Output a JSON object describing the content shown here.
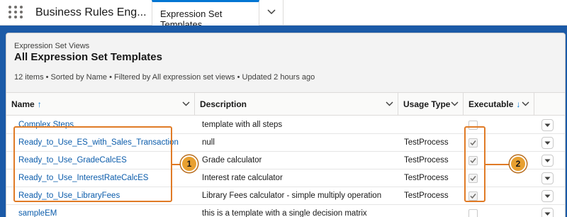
{
  "app": {
    "name": "Business Rules Eng...",
    "active_tab": "Expression Set Templates",
    "launcher_icon": "app-launcher-icon",
    "tab_menu_icon": "chevron-down-icon"
  },
  "list": {
    "views_label": "Expression Set Views",
    "title": "All Expression Set Templates",
    "meta": "12 items • Sorted by Name • Filtered by All expression set views • Updated 2 hours ago"
  },
  "columns": {
    "name": "Name",
    "name_sort": "↑",
    "description": "Description",
    "usage_type": "Usage Type",
    "executable": "Executable",
    "executable_sort": "↓"
  },
  "rows": [
    {
      "name": "Complex Steps",
      "description": "template with all steps",
      "usage_type": "",
      "executable": false
    },
    {
      "name": "Ready_to_Use_ES_with_Sales_Transaction",
      "description": "null",
      "usage_type": "TestProcess",
      "executable": true
    },
    {
      "name": "Ready_to_Use_GradeCalcES",
      "description": "Grade calculator",
      "usage_type": "TestProcess",
      "executable": true
    },
    {
      "name": "Ready_to_Use_InterestRateCalcES",
      "description": "Interest rate calculator",
      "usage_type": "TestProcess",
      "executable": true
    },
    {
      "name": "Ready_to_Use_LibraryFees",
      "description": "Library Fees calculator - simple multiply operation",
      "usage_type": "TestProcess",
      "executable": true
    },
    {
      "name": "sampleEM",
      "description": "this is a template with a single decision matrix",
      "usage_type": "",
      "executable": false
    }
  ],
  "callouts": [
    {
      "number": "1"
    },
    {
      "number": "2"
    }
  ],
  "colors": {
    "brand_blue": "#1b5aa7",
    "link": "#0b5cab",
    "callout": "#e07b26"
  }
}
